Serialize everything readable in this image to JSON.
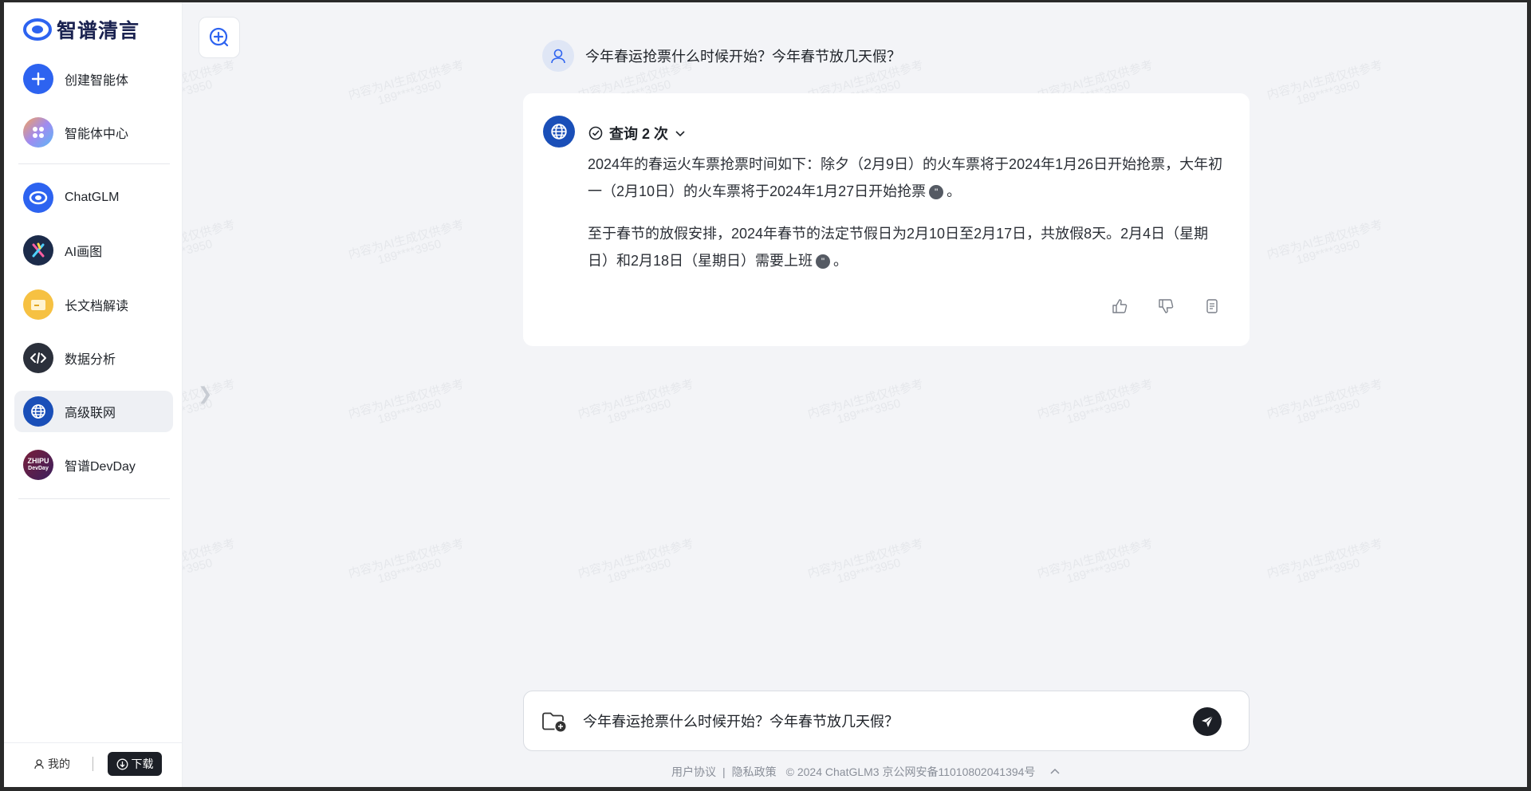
{
  "brand": {
    "name": "智谱清言"
  },
  "sidebar": {
    "items": [
      {
        "label": "创建智能体",
        "icon": "plus-icon",
        "color": "#2d63f0"
      },
      {
        "label": "智能体中心",
        "icon": "grid-dots-icon",
        "color": "#a08bf0"
      },
      {
        "label": "ChatGLM",
        "icon": "chatglm-logo-icon",
        "color": "#2d63f0"
      },
      {
        "label": "AI画图",
        "icon": "brush-x-icon",
        "color": "#1c2b4a"
      },
      {
        "label": "长文档解读",
        "icon": "folder-icon",
        "color": "#f6c142"
      },
      {
        "label": "数据分析",
        "icon": "code-icon",
        "color": "#2b303b"
      },
      {
        "label": "高级联网",
        "icon": "globe-icon",
        "color": "#1a4fb8"
      },
      {
        "label": "智谱DevDay",
        "icon": "zhipu-devday-icon",
        "color": "#3b1f5e",
        "icon_text_1": "ZHIPU",
        "icon_text_2": "DevDay"
      }
    ],
    "active_index": 6,
    "footer": {
      "mine_label": "我的",
      "download_label": "下载"
    }
  },
  "watermark": {
    "line1": "内容为AI生成仅供参考",
    "line2": "189****3950"
  },
  "chat": {
    "user_message": "今年春运抢票什么时候开始？今年春节放几天假？",
    "query_label": "查询 2 次",
    "answer_paragraphs": [
      {
        "text": "2024年的春运火车票抢票时间如下：除夕（2月9日）的火车票将于2024年1月26日开始抢票，大年初一（2月10日）的火车票将于2024年1月27日开始抢票",
        "cite": "\"",
        "end": "。"
      },
      {
        "text": "至于春节的放假安排，2024年春节的法定节假日为2月10日至2月17日，共放假8天。2月4日（星期日）和2月18日（星期日）需要上班",
        "cite": "\"",
        "end": "。"
      }
    ]
  },
  "input": {
    "value": "今年春运抢票什么时候开始？今年春节放几天假？"
  },
  "footer": {
    "user_agreement": "用户协议",
    "separator": "|",
    "privacy": "隐私政策",
    "copyright": "© 2024 ChatGLM3 京公网安备11010802041394号"
  },
  "colors": {
    "accent": "#2d63f0",
    "dark": "#1c1f26",
    "background": "#f3f4f7"
  }
}
